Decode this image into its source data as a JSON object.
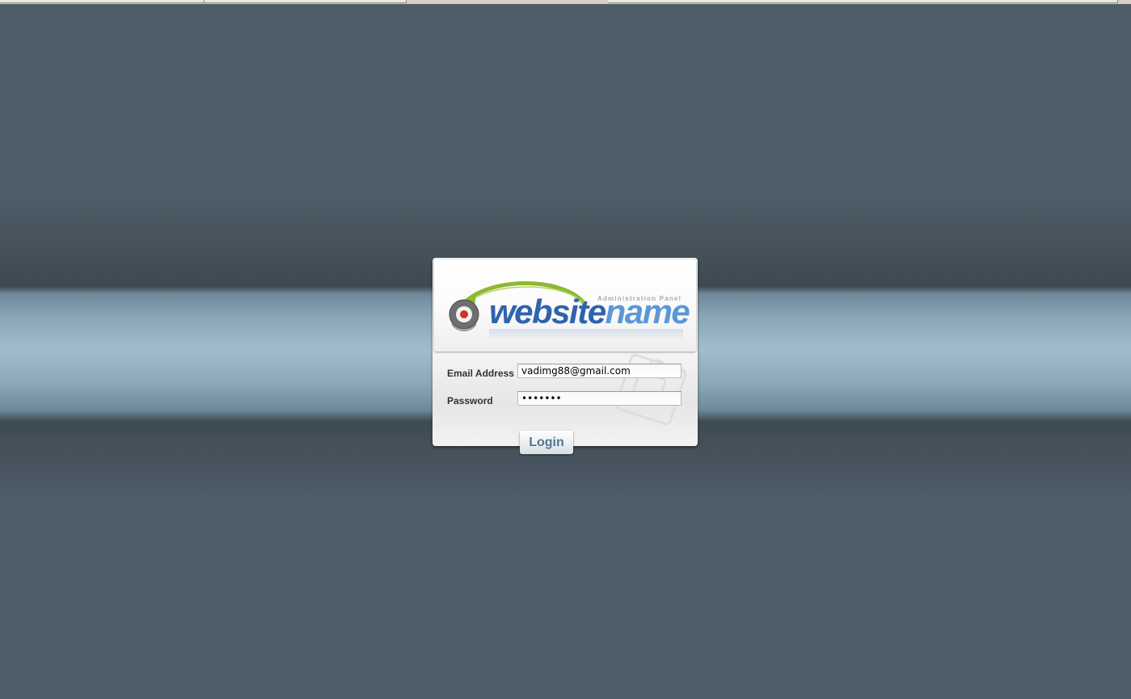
{
  "logo": {
    "tagline": "Administration Panel",
    "name_part1": "website",
    "name_part2": "name"
  },
  "form": {
    "email_label": "Email Address",
    "email_value": "vadimg88@gmail.com",
    "password_label": "Password",
    "password_value": "1234567",
    "login_label": "Login"
  },
  "colors": {
    "background": "#4f5d68",
    "band": "#a2bccb",
    "logo_dark_blue": "#2f63ad",
    "logo_light_blue": "#5b97d8",
    "arrow_green": "#8cb833",
    "login_text": "#4e7892"
  }
}
